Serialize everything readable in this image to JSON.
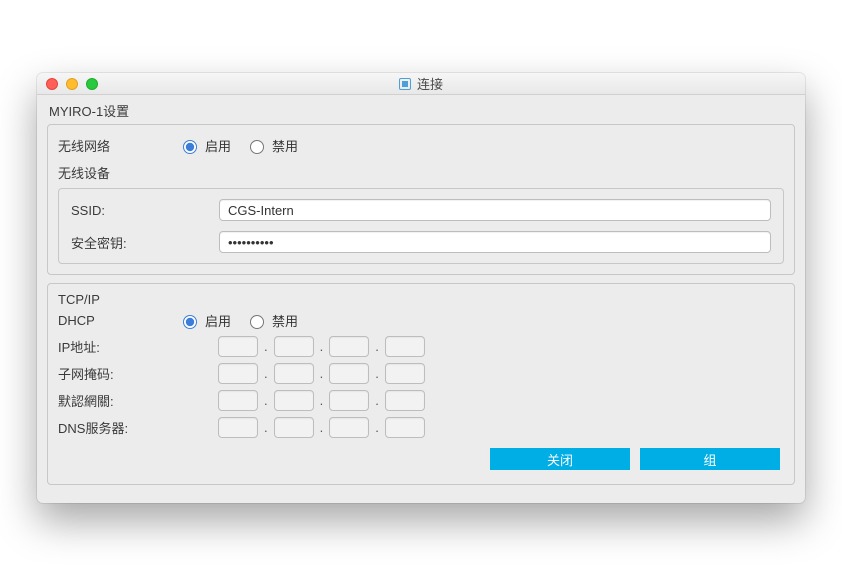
{
  "window": {
    "title": "连接"
  },
  "header": {
    "title": "MYIRO-1设置"
  },
  "wireless": {
    "label": "无线网络",
    "enable": "启用",
    "disable": "禁用",
    "selected": "enable",
    "device_title": "无线设备",
    "ssid_label": "SSID:",
    "ssid_value": "CGS-Intern",
    "key_label": "安全密钥:",
    "key_value": "••••••••••"
  },
  "tcpip": {
    "title": "TCP/IP",
    "dhcp_label": "DHCP",
    "enable": "启用",
    "disable": "禁用",
    "selected": "enable",
    "ip_label": "IP地址:",
    "subnet_label": "子网掩码:",
    "gateway_label": "默認網關:",
    "dns_label": "DNS服务器:",
    "ip": [
      "",
      "",
      "",
      ""
    ],
    "subnet": [
      "",
      "",
      "",
      ""
    ],
    "gateway": [
      "",
      "",
      "",
      ""
    ],
    "dns": [
      "",
      "",
      "",
      ""
    ]
  },
  "buttons": {
    "close": "关闭",
    "group": "组"
  }
}
